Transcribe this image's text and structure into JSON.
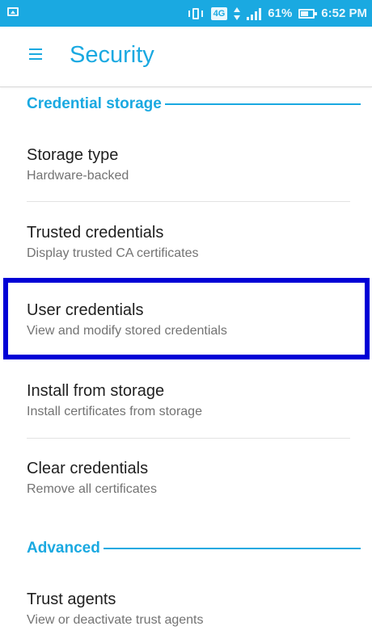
{
  "status_bar": {
    "lte_label": "4G",
    "battery_percent": "61%",
    "battery_level": 0.61,
    "time": "6:52 PM",
    "icons": [
      "image-icon",
      "vibrate-icon",
      "data-arrows-icon",
      "signal-icon",
      "battery-icon"
    ]
  },
  "app_bar": {
    "title": "Security"
  },
  "sections": {
    "credential_storage": "Credential storage",
    "advanced": "Advanced"
  },
  "items": [
    {
      "title": "Storage type",
      "subtitle": "Hardware-backed"
    },
    {
      "title": "Trusted credentials",
      "subtitle": "Display trusted CA certificates"
    },
    {
      "title": "User credentials",
      "subtitle": "View and modify stored credentials"
    },
    {
      "title": "Install from storage",
      "subtitle": "Install certificates from storage"
    },
    {
      "title": "Clear credentials",
      "subtitle": "Remove all certificates"
    },
    {
      "title": "Trust agents",
      "subtitle": "View or deactivate trust agents"
    }
  ],
  "colors": {
    "accent": "#1aa9e1",
    "highlight_border": "#0000d6"
  }
}
